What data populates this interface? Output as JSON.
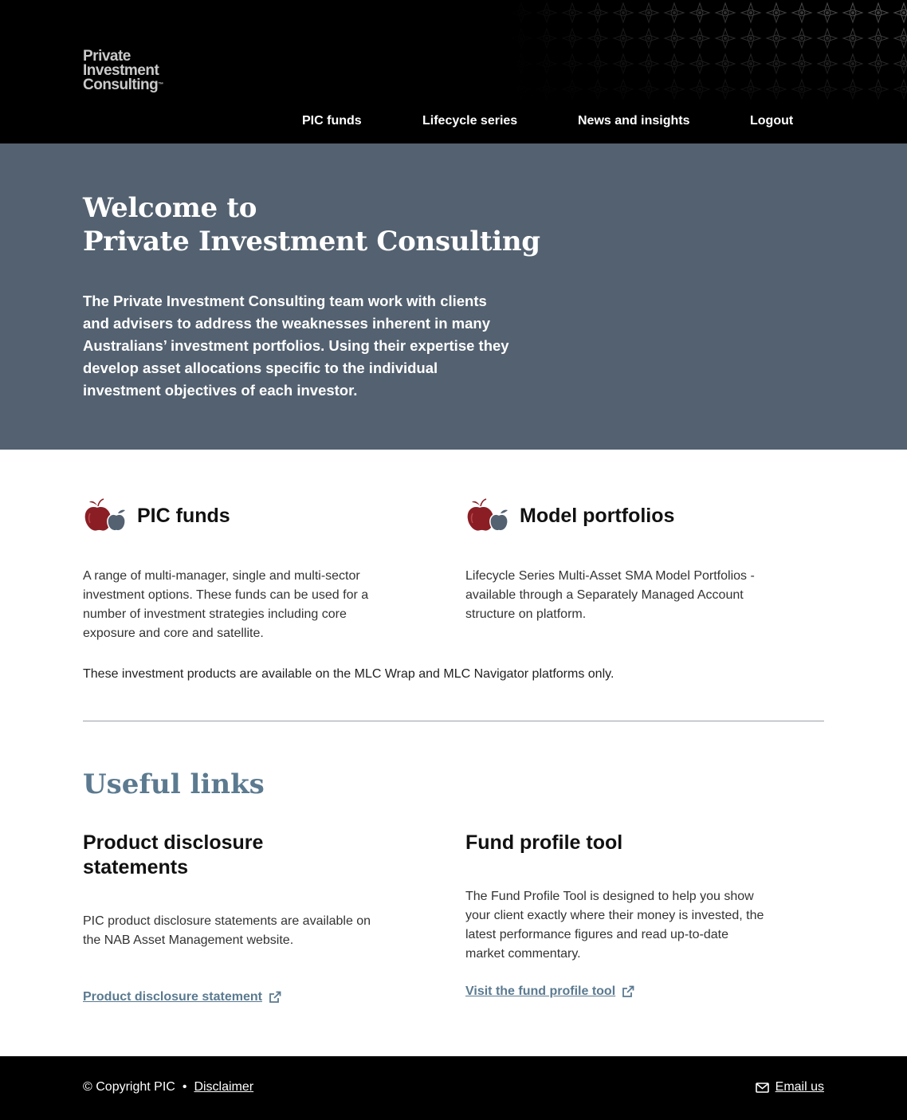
{
  "header": {
    "logo_lines": [
      "Private",
      "Investment",
      "Consulting"
    ],
    "logo_tm": "™",
    "nav": [
      {
        "label": "PIC funds"
      },
      {
        "label": "Lifecycle series"
      },
      {
        "label": "News and insights"
      },
      {
        "label": "Logout"
      }
    ]
  },
  "hero": {
    "title_line1": "Welcome to",
    "title_line2": "Private Investment Consulting",
    "text": "The Private Investment Consulting team work with clients and advisers to address the weaknesses inherent in many Australians’ investment portfolios. Using their expertise they develop asset allocations specific to the individual investment objectives of each investor."
  },
  "products": {
    "cards": [
      {
        "title": "PIC funds",
        "icon": "apples-icon",
        "text": "A range of multi-manager, single and multi-sector investment options. These funds can be used for a number of investment strategies including core exposure and core and satellite."
      },
      {
        "title": "Model portfolios",
        "icon": "apples-icon",
        "text": "Lifecycle Series Multi-Asset SMA Model Portfolios - available through a Separately Managed Account structure on platform."
      }
    ],
    "note": "These investment products are available on the MLC Wrap and MLC Navigator platforms only."
  },
  "useful_links": {
    "title": "Useful links",
    "items": [
      {
        "title": "Product disclosure statements",
        "text": "PIC product disclosure statements are available on the NAB Asset Management website.",
        "link_label": "Product disclosure statement",
        "link_icon": "external-link-icon"
      },
      {
        "title": "Fund profile tool",
        "text": "The Fund Profile Tool is designed to help you show your client exactly where their money is invested, the latest performance figures and read up-to-date market commentary.",
        "link_label": "Visit the fund profile tool",
        "link_icon": "external-link-icon"
      }
    ]
  },
  "footer": {
    "copyright": "© Copyright PIC",
    "separator": "•",
    "disclaimer": "Disclaimer",
    "email_label": "Email us",
    "email_icon": "envelope-icon"
  },
  "colors": {
    "header_bg": "#000000",
    "hero_bg": "#536170",
    "accent": "#5b7a90",
    "apple_red": "#8b1e24",
    "apple_slate": "#536170"
  }
}
